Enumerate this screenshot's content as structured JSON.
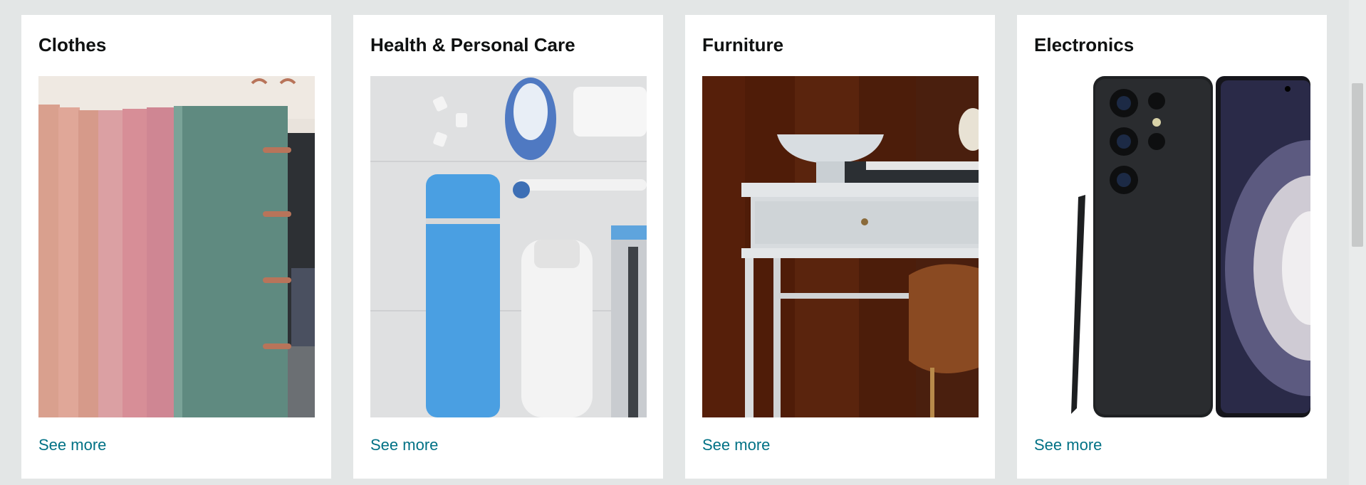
{
  "cards": [
    {
      "title": "Clothes",
      "link": "See more",
      "image": "folded-clothes-on-rack"
    },
    {
      "title": "Health & Personal Care",
      "link": "See more",
      "image": "toiletries-flat-lay"
    },
    {
      "title": "Furniture",
      "link": "See more",
      "image": "white-desk-with-bowl"
    },
    {
      "title": "Electronics",
      "link": "See more",
      "image": "black-smartphone-with-stylus"
    }
  ],
  "colors": {
    "page_bg": "#e3e6e6",
    "card_bg": "#ffffff",
    "link": "#007185",
    "title": "#0f1111"
  }
}
